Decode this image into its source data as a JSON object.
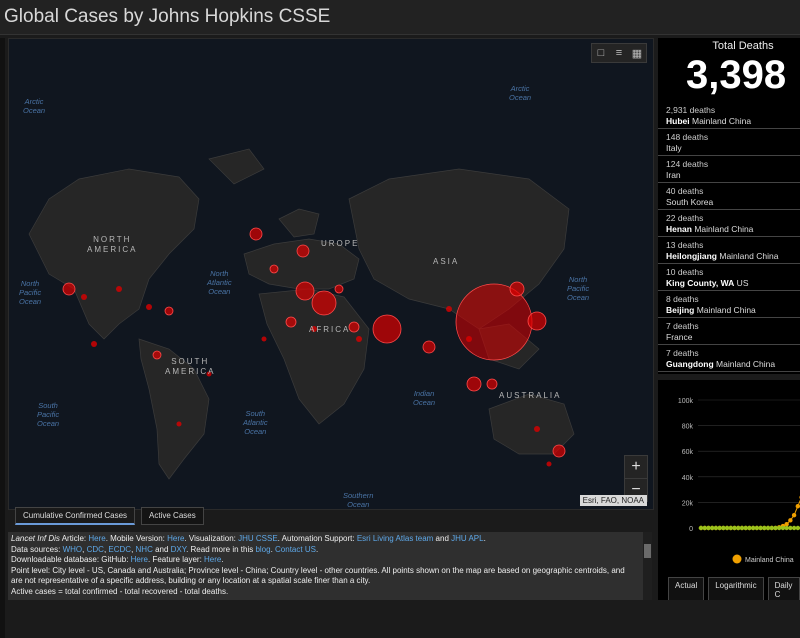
{
  "header": {
    "title": "Global Cases by Johns Hopkins CSSE"
  },
  "map": {
    "attribution": "Esri, FAO, NOAA",
    "ocean_labels": [
      {
        "text": "Arctic\nOcean"
      },
      {
        "text": "Arctic\nOcean"
      },
      {
        "text": "North\nAtlantic\nOcean"
      },
      {
        "text": "North\nPacific\nOcean"
      },
      {
        "text": "North\nPacific\nOcean"
      },
      {
        "text": "South\nPacific\nOcean"
      },
      {
        "text": "South\nAtlantic\nOcean"
      },
      {
        "text": "Indian\nOcean"
      },
      {
        "text": "Southern\nOcean"
      }
    ],
    "continent_labels": [
      {
        "text": "NORTH\nAMERICA"
      },
      {
        "text": "UROPE"
      },
      {
        "text": "ASIA"
      },
      {
        "text": "AFRICA"
      },
      {
        "text": "SOUTH\nAMERICA"
      },
      {
        "text": "AUSTRALIA"
      }
    ],
    "zoom_in": "+",
    "zoom_out": "−"
  },
  "tabs": {
    "cumulative": "Cumulative Confirmed Cases",
    "active": "Active Cases"
  },
  "info": {
    "line1_prefix": "Lancet Inf Dis",
    "line1_a": " Article: ",
    "here1": "Here",
    "line1_b": ". Mobile Version: ",
    "here2": "Here",
    "line1_c": ". Visualization: ",
    "jhu": "JHU CSSE",
    "line1_d": ". Automation Support: ",
    "esri": "Esri Living Atlas team",
    "and": " and ",
    "apl": "JHU APL",
    "line2_prefix": "Data sources: ",
    "who": "WHO",
    "cdc": "CDC",
    "ecdc": "ECDC",
    "nhc": "NHC",
    "dxy": "DXY",
    "line2_mid": ". Read more in this ",
    "blog": "blog",
    "contact": "Contact US",
    "line3_prefix": "Downloadable database: GitHub: ",
    "here3": "Here",
    "line3_mid": ". Feature layer: ",
    "here4": "Here",
    "line4": "Point level: City level - US, Canada and Australia; Province level - China; Country level - other countries. All points shown on the map are based on geographic centroids, and are not representative of a specific address, building or any location at a spatial scale finer than a city.",
    "line5": "Active cases = total confirmed - total recovered - total deaths."
  },
  "deaths": {
    "label": "Total Deaths",
    "total": "3,398",
    "rows": [
      {
        "count": "2,931 deaths",
        "bold": "Hubei",
        "place": " Mainland China"
      },
      {
        "count": "148 deaths",
        "bold": "",
        "place": "Italy"
      },
      {
        "count": "124 deaths",
        "bold": "",
        "place": "Iran"
      },
      {
        "count": "40 deaths",
        "bold": "",
        "place": "South Korea"
      },
      {
        "count": "22 deaths",
        "bold": "Henan",
        "place": " Mainland China"
      },
      {
        "count": "13 deaths",
        "bold": "Heilongjiang",
        "place": " Mainland China"
      },
      {
        "count": "10 deaths",
        "bold": "King County, WA",
        "place": " US"
      },
      {
        "count": "8 deaths",
        "bold": "Beijing",
        "place": " Mainland China"
      },
      {
        "count": "7 deaths",
        "bold": "",
        "place": "France"
      },
      {
        "count": "7 deaths",
        "bold": "Guangdong",
        "place": " Mainland China"
      }
    ]
  },
  "chart": {
    "legend": "Mainland China",
    "tabs": [
      "Actual",
      "Logarithmic",
      "Daily C"
    ],
    "series_color": "#f0a000",
    "other_color": "#9bc21c"
  },
  "chart_data": {
    "type": "line",
    "ylim": [
      0,
      100000
    ],
    "y_ticks": [
      "100k",
      "80k",
      "60k",
      "40k",
      "20k",
      "0"
    ],
    "series": [
      {
        "name": "Mainland China",
        "values": [
          0,
          0,
          0,
          0,
          0,
          0,
          0,
          0,
          0,
          0,
          0,
          0,
          0,
          0,
          0,
          0,
          0,
          0,
          0,
          0,
          0,
          500,
          1500,
          3000,
          6000,
          10000,
          17000,
          24000,
          31000,
          40000
        ]
      },
      {
        "values": [
          0,
          0,
          0,
          0,
          0,
          0,
          0,
          0,
          0,
          0,
          0,
          0,
          0,
          0,
          0,
          0,
          0,
          0,
          0,
          0,
          0,
          0,
          0,
          0,
          0,
          0,
          0,
          0,
          0,
          0
        ]
      }
    ]
  }
}
